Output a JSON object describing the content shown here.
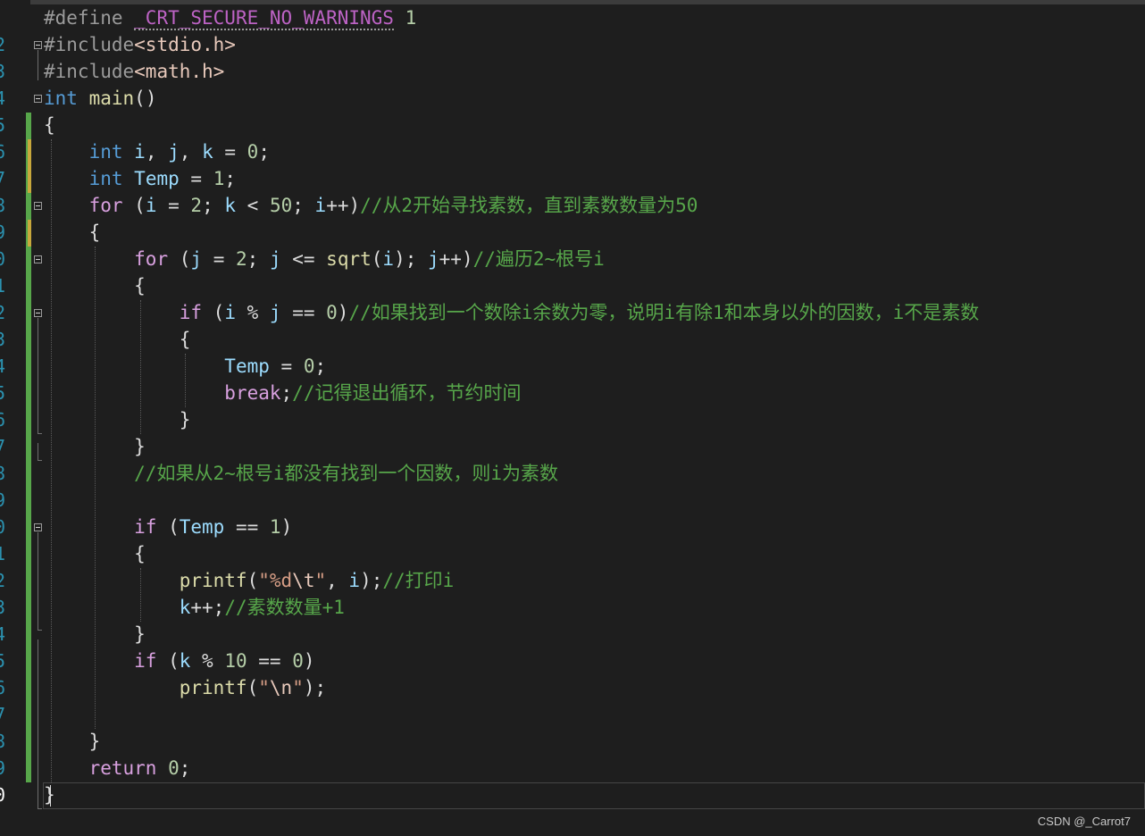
{
  "editor": {
    "line_numbers": [
      "2",
      "3",
      "4",
      "5",
      "6",
      "7",
      "8",
      "9",
      "0",
      "1",
      "2",
      "3",
      "4",
      "5",
      "6",
      "7",
      "8",
      "9",
      "0",
      "1",
      "2",
      "3",
      "4",
      "5",
      "6",
      "7",
      "8",
      "9",
      "0"
    ],
    "lines": [
      [
        [
          "pp",
          "#define "
        ],
        [
          "mac",
          "_CRT_SECURE_NO_WARNINGS"
        ],
        [
          "pp",
          " "
        ],
        [
          "num",
          "1"
        ]
      ],
      [
        [
          "pp",
          "#include"
        ],
        [
          "inc",
          "<stdio.h>"
        ]
      ],
      [
        [
          "pp",
          "#include"
        ],
        [
          "inc",
          "<math.h>"
        ]
      ],
      [
        [
          "kw",
          "int"
        ],
        [
          "plain",
          " "
        ],
        [
          "fn",
          "main"
        ],
        [
          "plain",
          "()"
        ]
      ],
      [
        [
          "plain",
          "{"
        ]
      ],
      [
        [
          "plain",
          "    "
        ],
        [
          "kw",
          "int"
        ],
        [
          "plain",
          " "
        ],
        [
          "var",
          "i"
        ],
        [
          "plain",
          ", "
        ],
        [
          "var",
          "j"
        ],
        [
          "plain",
          ", "
        ],
        [
          "var",
          "k"
        ],
        [
          "plain",
          " = "
        ],
        [
          "num",
          "0"
        ],
        [
          "plain",
          ";"
        ]
      ],
      [
        [
          "plain",
          "    "
        ],
        [
          "kw",
          "int"
        ],
        [
          "plain",
          " "
        ],
        [
          "var",
          "Temp"
        ],
        [
          "plain",
          " = "
        ],
        [
          "num",
          "1"
        ],
        [
          "plain",
          ";"
        ]
      ],
      [
        [
          "plain",
          "    "
        ],
        [
          "ctl",
          "for"
        ],
        [
          "plain",
          " ("
        ],
        [
          "var",
          "i"
        ],
        [
          "plain",
          " = "
        ],
        [
          "num",
          "2"
        ],
        [
          "plain",
          "; "
        ],
        [
          "var",
          "k"
        ],
        [
          "plain",
          " < "
        ],
        [
          "num",
          "50"
        ],
        [
          "plain",
          "; "
        ],
        [
          "var",
          "i"
        ],
        [
          "plain",
          "++)"
        ],
        [
          "cmt",
          "//从2开始寻找素数，直到素数数量为50"
        ]
      ],
      [
        [
          "plain",
          "    {"
        ]
      ],
      [
        [
          "plain",
          "        "
        ],
        [
          "ctl",
          "for"
        ],
        [
          "plain",
          " ("
        ],
        [
          "var",
          "j"
        ],
        [
          "plain",
          " = "
        ],
        [
          "num",
          "2"
        ],
        [
          "plain",
          "; "
        ],
        [
          "var",
          "j"
        ],
        [
          "plain",
          " <= "
        ],
        [
          "fn",
          "sqrt"
        ],
        [
          "plain",
          "("
        ],
        [
          "var",
          "i"
        ],
        [
          "plain",
          "); "
        ],
        [
          "var",
          "j"
        ],
        [
          "plain",
          "++)"
        ],
        [
          "cmt",
          "//遍历2~根号i"
        ]
      ],
      [
        [
          "plain",
          "        {"
        ]
      ],
      [
        [
          "plain",
          "            "
        ],
        [
          "ctl",
          "if"
        ],
        [
          "plain",
          " ("
        ],
        [
          "var",
          "i"
        ],
        [
          "plain",
          " % "
        ],
        [
          "var",
          "j"
        ],
        [
          "plain",
          " == "
        ],
        [
          "num",
          "0"
        ],
        [
          "plain",
          ")"
        ],
        [
          "cmt",
          "//如果找到一个数除i余数为零，说明i有除1和本身以外的因数，i不是素数"
        ]
      ],
      [
        [
          "plain",
          "            {"
        ]
      ],
      [
        [
          "plain",
          "                "
        ],
        [
          "var",
          "Temp"
        ],
        [
          "plain",
          " = "
        ],
        [
          "num",
          "0"
        ],
        [
          "plain",
          ";"
        ]
      ],
      [
        [
          "plain",
          "                "
        ],
        [
          "ctl",
          "break"
        ],
        [
          "plain",
          ";"
        ],
        [
          "cmt",
          "//记得退出循环，节约时间"
        ]
      ],
      [
        [
          "plain",
          "            }"
        ]
      ],
      [
        [
          "plain",
          "        }"
        ]
      ],
      [
        [
          "plain",
          "        "
        ],
        [
          "cmt",
          "//如果从2~根号i都没有找到一个因数，则i为素数"
        ]
      ],
      [],
      [
        [
          "plain",
          "        "
        ],
        [
          "ctl",
          "if"
        ],
        [
          "plain",
          " ("
        ],
        [
          "var",
          "Temp"
        ],
        [
          "plain",
          " == "
        ],
        [
          "num",
          "1"
        ],
        [
          "plain",
          ")"
        ]
      ],
      [
        [
          "plain",
          "        {"
        ]
      ],
      [
        [
          "plain",
          "            "
        ],
        [
          "fn",
          "printf"
        ],
        [
          "plain",
          "("
        ],
        [
          "str",
          "\"%d"
        ],
        [
          "esc",
          "\\t"
        ],
        [
          "str",
          "\""
        ],
        [
          "plain",
          ", "
        ],
        [
          "var",
          "i"
        ],
        [
          "plain",
          ");"
        ],
        [
          "cmt",
          "//打印i"
        ]
      ],
      [
        [
          "plain",
          "            "
        ],
        [
          "var",
          "k"
        ],
        [
          "plain",
          "++;"
        ],
        [
          "cmt",
          "//素数数量+1"
        ]
      ],
      [
        [
          "plain",
          "        }"
        ]
      ],
      [
        [
          "plain",
          "        "
        ],
        [
          "ctl",
          "if"
        ],
        [
          "plain",
          " ("
        ],
        [
          "var",
          "k"
        ],
        [
          "plain",
          " % "
        ],
        [
          "num",
          "10"
        ],
        [
          "plain",
          " == "
        ],
        [
          "num",
          "0"
        ],
        [
          "plain",
          ")"
        ]
      ],
      [
        [
          "plain",
          "            "
        ],
        [
          "fn",
          "printf"
        ],
        [
          "plain",
          "("
        ],
        [
          "str",
          "\""
        ],
        [
          "esc",
          "\\n"
        ],
        [
          "str",
          "\""
        ],
        [
          "plain",
          ");"
        ]
      ],
      [],
      [
        [
          "plain",
          "    }"
        ]
      ],
      [
        [
          "plain",
          "    "
        ],
        [
          "ctl",
          "return"
        ],
        [
          "plain",
          " "
        ],
        [
          "num",
          "0"
        ],
        [
          "plain",
          ";"
        ]
      ],
      [
        [
          "plain",
          "}"
        ]
      ]
    ]
  },
  "watermark": "CSDN @_Carrot7"
}
